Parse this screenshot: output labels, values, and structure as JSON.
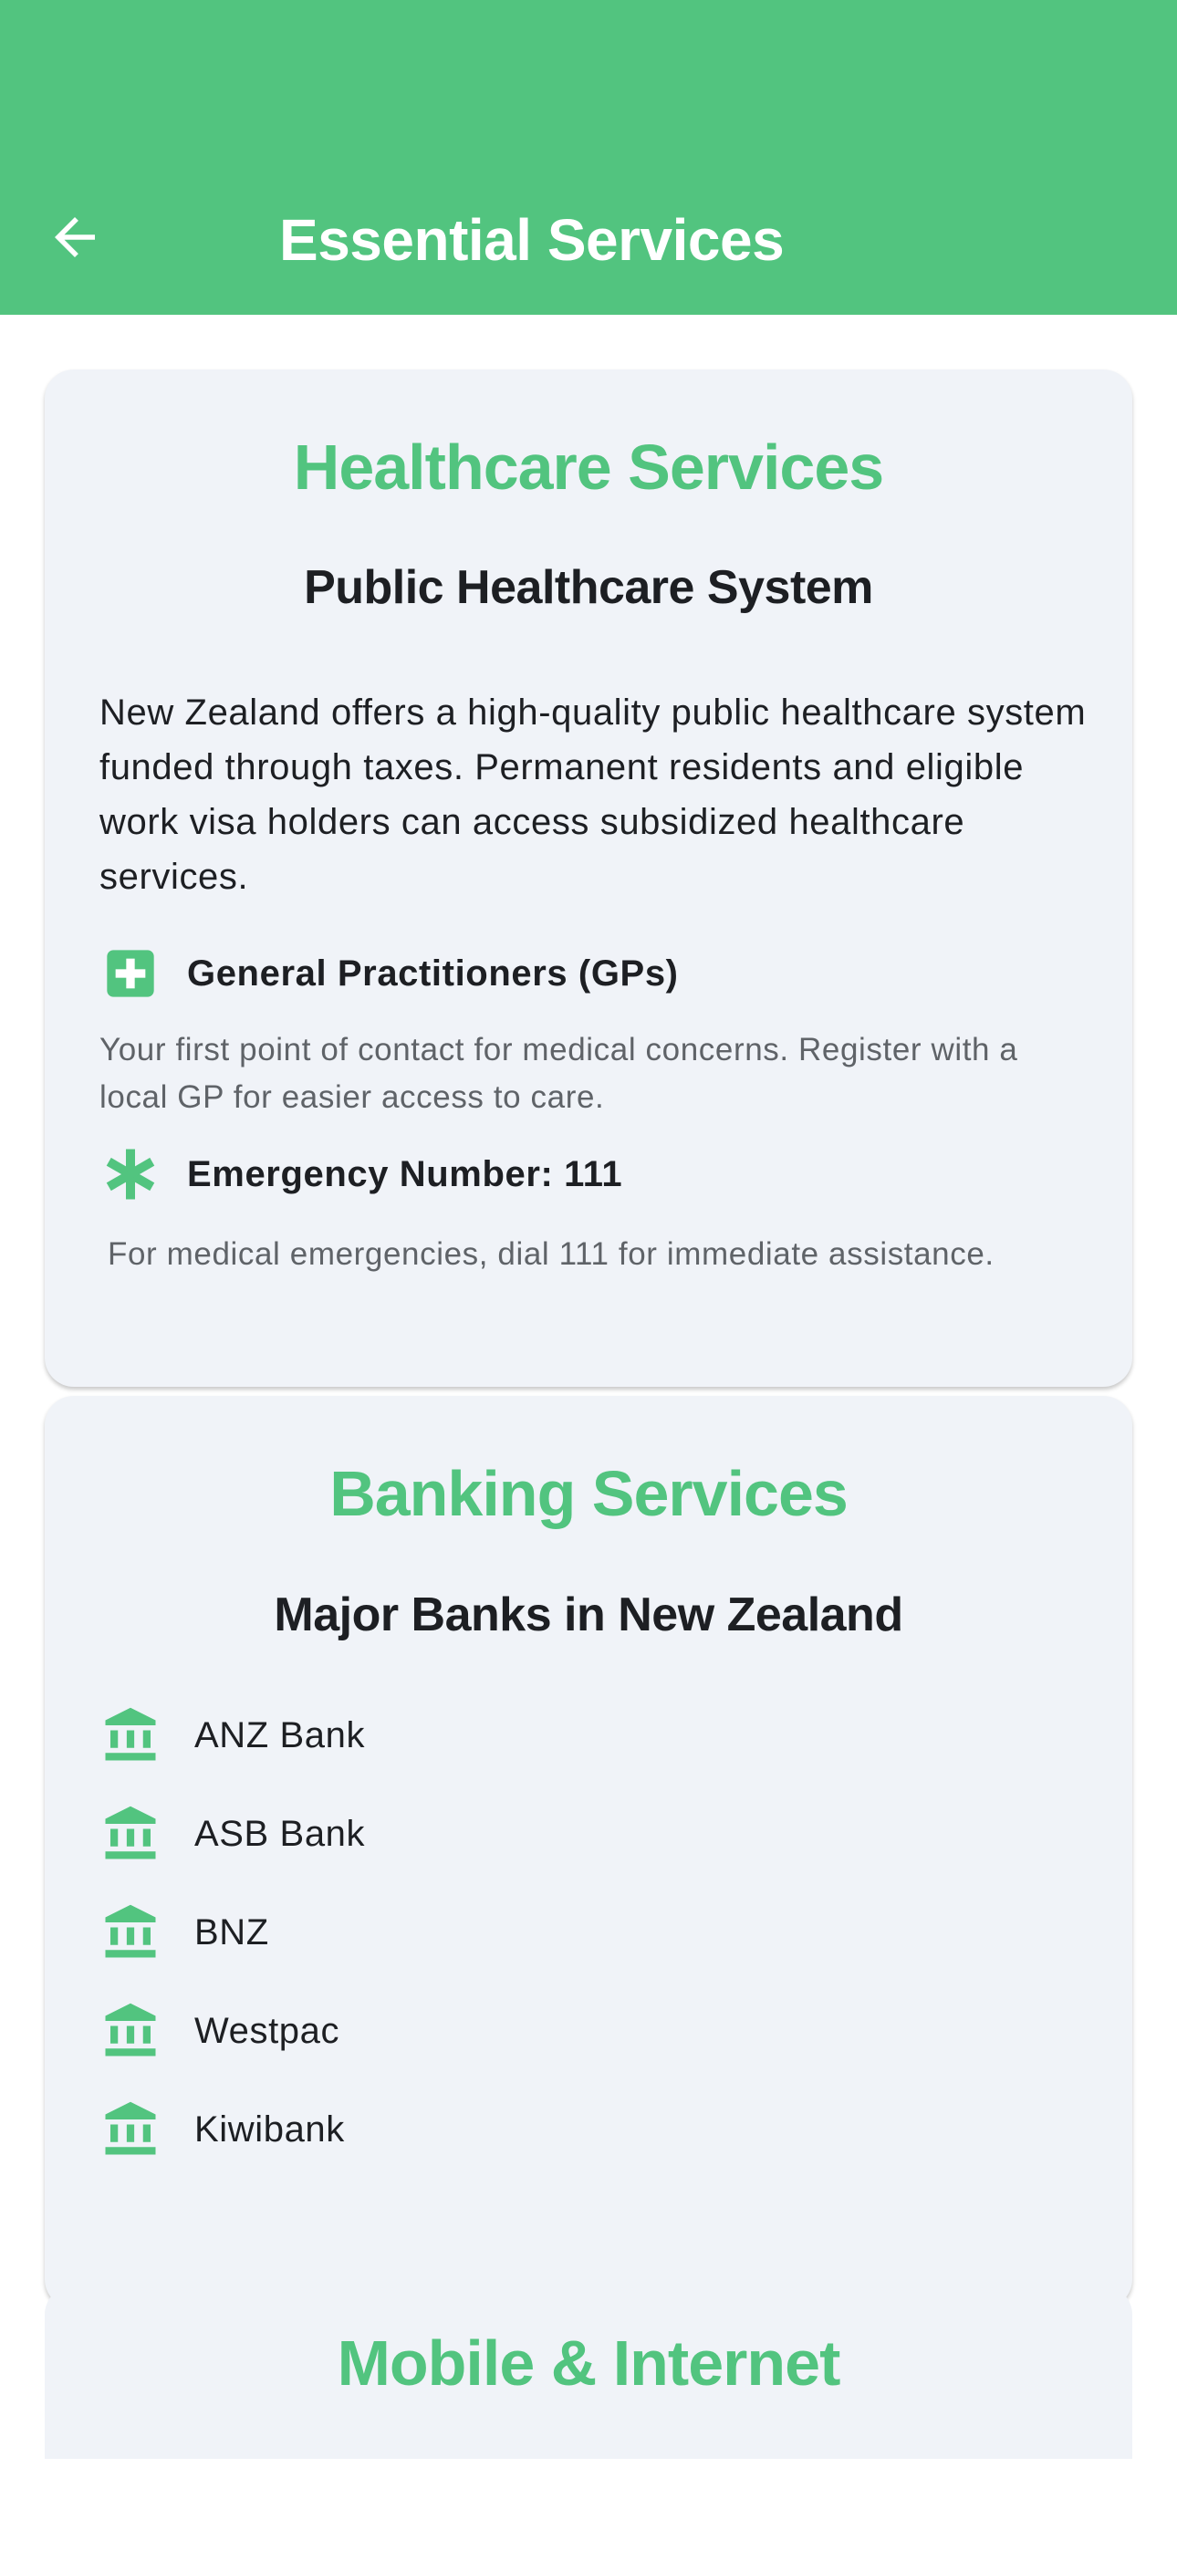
{
  "header": {
    "title": "Essential Services",
    "back_icon": "arrow-left-icon"
  },
  "colors": {
    "primary": "#52c47f",
    "card_bg": "#f0f3f8",
    "text_dark": "#1d1f23",
    "text_muted": "#5f6368"
  },
  "healthcare": {
    "title": "Healthcare Services",
    "subtitle": "Public Healthcare System",
    "intro": "New Zealand offers a high-quality public healthcare system funded through taxes. Permanent residents and eligible work visa holders can access subsidized healthcare services.",
    "features": [
      {
        "icon": "medical-cross-icon",
        "title": "General Practitioners (GPs)",
        "description": "Your first point of contact for medical concerns. Register with a local GP for easier access to care."
      },
      {
        "icon": "asterisk-icon",
        "title": "Emergency Number: 111",
        "description": "For medical emergencies, dial 111 for immediate assistance."
      }
    ]
  },
  "banking": {
    "title": "Banking Services",
    "subtitle": "Major Banks in New Zealand",
    "banks": [
      {
        "name": "ANZ Bank",
        "icon": "bank-icon"
      },
      {
        "name": "ASB Bank",
        "icon": "bank-icon"
      },
      {
        "name": "BNZ",
        "icon": "bank-icon"
      },
      {
        "name": "Westpac",
        "icon": "bank-icon"
      },
      {
        "name": "Kiwibank",
        "icon": "bank-icon"
      }
    ]
  },
  "mobile": {
    "title": "Mobile & Internet"
  }
}
